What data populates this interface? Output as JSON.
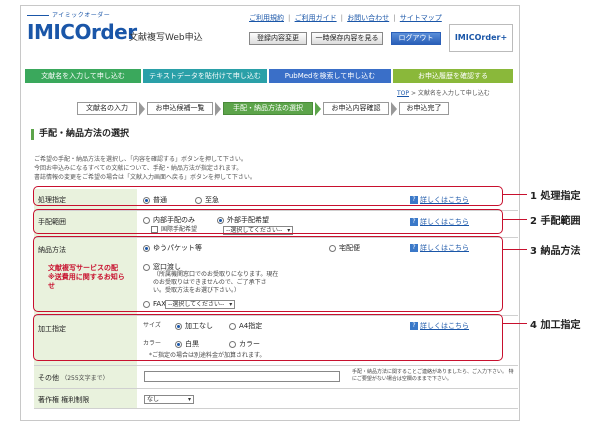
{
  "header": {
    "logo_kana": "アイミックオーダー",
    "logo": "IMICOrder",
    "subtitle": "文献複写Web申込",
    "links": [
      "ご利用規約",
      "ご利用ガイド",
      "お問い合わせ",
      "サイトマップ"
    ],
    "btn_change_info": "登録内容変更",
    "btn_save_temp": "一時保存内容を見る",
    "btn_logout": "ログアウト",
    "brand": "IMICOrder+"
  },
  "nav": {
    "tab1": "文献名を入力して申し込む",
    "tab2": "テキストデータを貼付けて申し込む",
    "tab3": "PubMedを検索して申し込む",
    "tab4": "お申込履歴を確認する"
  },
  "breadcrumb": {
    "top": "TOP",
    "current": "> 文献名を入力して申し込む"
  },
  "steps": [
    "文献名の入力",
    "お申込候補一覧",
    "手配・納品方法の選択",
    "お申込内容確認",
    "お申込完了"
  ],
  "section_title": "手配・納品方法の選択",
  "intro": [
    "ご希望の手配・納品方法を選択し、「内容を確認する」ボタンを押して下さい。",
    "今回お申込みになるすべての文献について、手配・納品方法が指定されます。",
    "書誌情報の変更をご希望の場合は「文献入力画面へ戻る」ボタンを押して下さい。"
  ],
  "help_link": "詳しくはこちら",
  "rows": {
    "processing": {
      "label": "処理指定",
      "opt1": "普通",
      "opt2": "至急"
    },
    "range": {
      "label": "手配範囲",
      "opt1": "内部手配のみ",
      "opt2": "外部手配希望",
      "chk": "国際手配希望",
      "select": "--選択してください--"
    },
    "delivery": {
      "label": "納品方法",
      "note": "文献複写サービスの配\n※送費用に関するお知ら\nせ",
      "opt1": "ゆうパケット等",
      "opt2": "宅配便",
      "opt3": "窓口渡し",
      "opt3_note": "（所属機関窓口でのお受取りになります。現在\nのお受取りはできませんので、ご了承下さ\nい。受取方法をお選び下さい。）",
      "opt4": "FAX",
      "select": "--選択してください--"
    },
    "processing_opts": {
      "label": "加工指定",
      "size_label": "サイズ",
      "size1": "加工なし",
      "size2": "A4指定",
      "color_label": "カラー",
      "color1": "白黒",
      "color2": "カラー",
      "note": "*ご指定の場合は別途料金が加算されます。"
    },
    "other": {
      "label": "その他",
      "sub": "（255文字まで）",
      "note": "手配・納品方法に関することご連絡がありましたら、ご入力下さい。 特にご要望がない場合は空欄のままで下さい。"
    },
    "copyright": {
      "label": "著作権 権利制限",
      "select": "なし"
    }
  },
  "callouts": [
    "1 処理指定",
    "2 手配範囲",
    "3 納品方法",
    "4 加工指定"
  ],
  "colors": {
    "accent_green": "#5ca44a",
    "nav_green": "#3aa85c",
    "nav_teal": "#2aa0a8",
    "nav_blue": "#3a6fc8",
    "nav_olive": "#8ab83a",
    "callout_red": "#c8102e",
    "label_bg": "#e9f2dd"
  }
}
